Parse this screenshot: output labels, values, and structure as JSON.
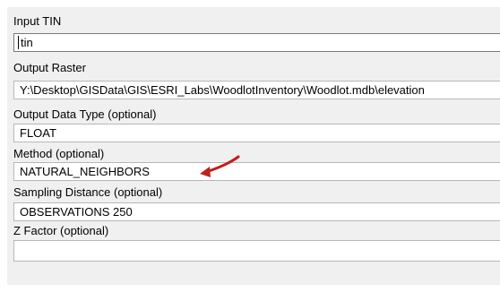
{
  "dialog": {
    "input_tin": {
      "label": "Input TIN",
      "value": "tin"
    },
    "output_raster": {
      "label": "Output Raster",
      "value": "Y:\\Desktop\\GISData\\GIS\\ESRI_Labs\\WoodlotInventory\\Woodlot.mdb\\elevation"
    },
    "output_data_type": {
      "label": "Output Data Type (optional)",
      "value": "FLOAT"
    },
    "method": {
      "label": "Method (optional)",
      "value": "NATURAL_NEIGHBORS"
    },
    "sampling_distance": {
      "label": "Sampling Distance (optional)",
      "value": "OBSERVATIONS 250"
    },
    "z_factor": {
      "label": "Z Factor (optional)",
      "value": ""
    }
  },
  "annotation": {
    "arrow_color": "#c0201a",
    "icon": "red-arrow-icon"
  }
}
